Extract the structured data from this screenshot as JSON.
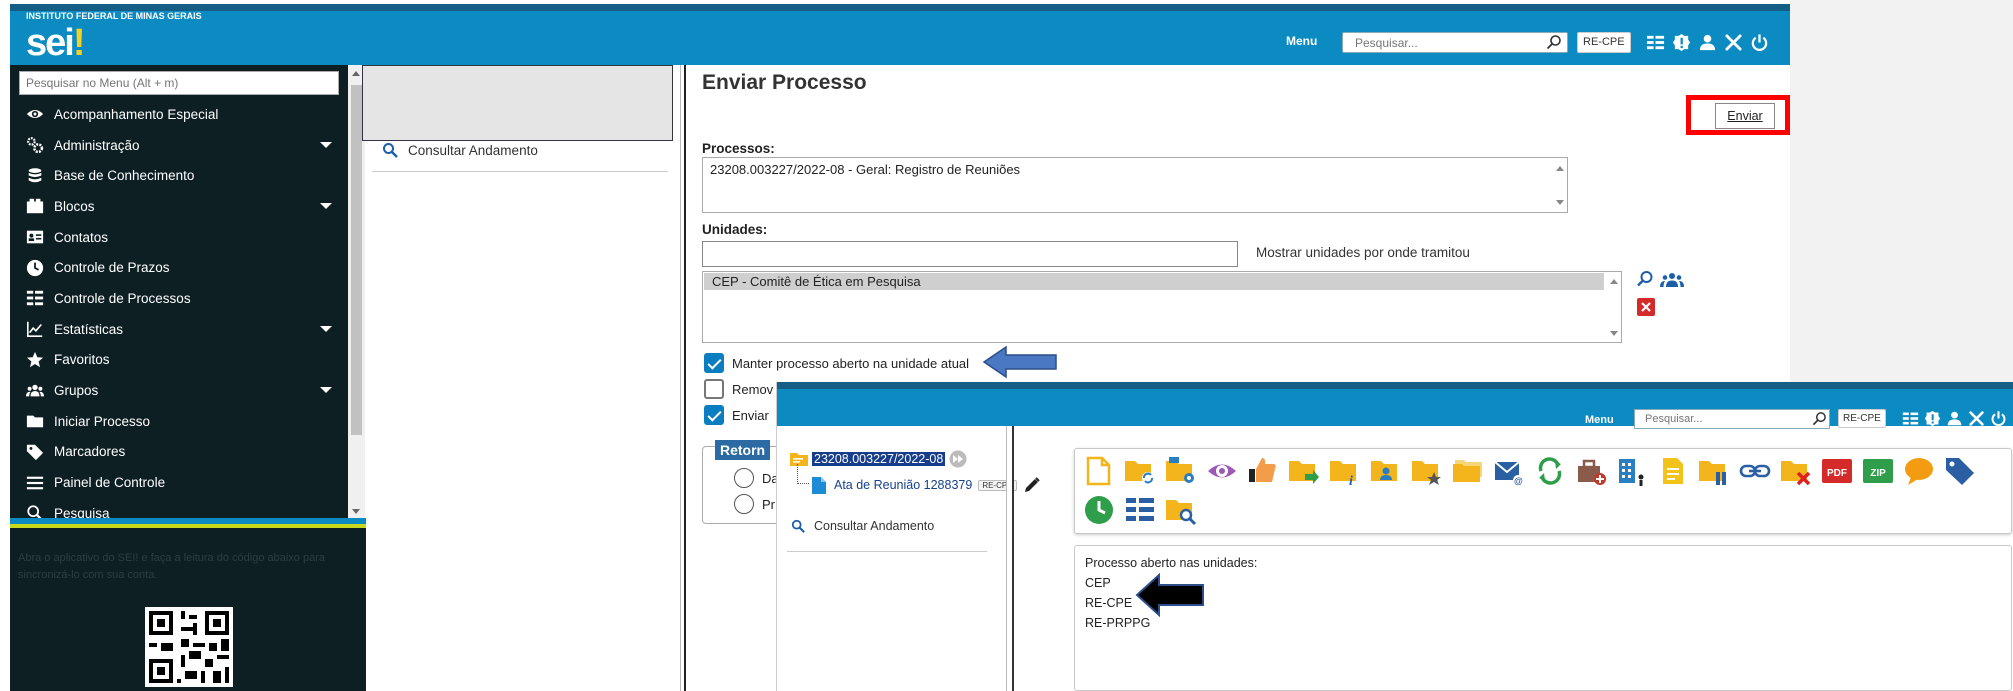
{
  "header": {
    "institution": "INSTITUTO FEDERAL DE MINAS GERAIS",
    "logo_main": "sei",
    "logo_mark": "!",
    "menu_label": "Menu",
    "search_placeholder": "Pesquisar...",
    "unit": "RE-CPE",
    "icons": [
      "grid-list-icon",
      "alert-icon",
      "user-icon",
      "tools-icon",
      "power-icon"
    ]
  },
  "sidebar": {
    "search_placeholder": "Pesquisar no Menu (Alt + m)",
    "items": [
      {
        "label": "Acompanhamento Especial",
        "icon": "eye-icon",
        "submenu": false
      },
      {
        "label": "Administração",
        "icon": "gears-icon",
        "submenu": true
      },
      {
        "label": "Base de Conhecimento",
        "icon": "database-icon",
        "submenu": false
      },
      {
        "label": "Blocos",
        "icon": "blocks-icon",
        "submenu": true
      },
      {
        "label": "Contatos",
        "icon": "contact-card-icon",
        "submenu": false
      },
      {
        "label": "Controle de Prazos",
        "icon": "clock-icon",
        "submenu": false
      },
      {
        "label": "Controle de Processos",
        "icon": "list-icon",
        "submenu": false
      },
      {
        "label": "Estatísticas",
        "icon": "chart-icon",
        "submenu": true
      },
      {
        "label": "Favoritos",
        "icon": "star-icon",
        "submenu": false
      },
      {
        "label": "Grupos",
        "icon": "group-icon",
        "submenu": true
      },
      {
        "label": "Iniciar Processo",
        "icon": "folder-icon",
        "submenu": false
      },
      {
        "label": "Marcadores",
        "icon": "tag-icon",
        "submenu": false
      },
      {
        "label": "Painel de Controle",
        "icon": "menu-lines-icon",
        "submenu": false
      },
      {
        "label": "Pesquisa",
        "icon": "search-icon",
        "submenu": false
      }
    ],
    "qr_text": "Abra o aplicativo do SEI! e faça a leitura do código abaixo para sincronizá-lo com sua conta."
  },
  "middle": {
    "consultar_label": "Consultar Andamento"
  },
  "main": {
    "title": "Enviar Processo",
    "enviar_button": "Enviar",
    "processos_label": "Processos:",
    "processo_item": "23208.003227/2022-08 - Geral: Registro de Reuniões",
    "unidades_label": "Unidades:",
    "mostrar_label": "Mostrar unidades por onde tramitou",
    "unidade_item": "CEP - Comitê de Ética em Pesquisa",
    "checkboxes": [
      {
        "label": "Manter processo aberto na unidade atual",
        "checked": true
      },
      {
        "label": "Remov",
        "checked": false
      },
      {
        "label": "Enviar",
        "checked": true
      }
    ],
    "retorno_label": "Retorn",
    "radio_labels": [
      "Da",
      "Pr"
    ]
  },
  "inset": {
    "menu_label": "Menu",
    "search_placeholder": "Pesquisar...",
    "unit": "RE-CPE",
    "process_number": "23208.003227/2022-08",
    "document_label": "Ata de Reunião 1288379",
    "document_badge": "RE-CPE",
    "consultar_label": "Consultar Andamento",
    "info_title": "Processo aberto nas unidades:",
    "open_units": [
      "CEP",
      "RE-CPE",
      "RE-PRPPG"
    ],
    "toolbar_text": {
      "pdf": "PDF",
      "zip": "ZIP"
    }
  },
  "colors": {
    "header_blue": "#0b8bc1",
    "header_dark": "#155f86",
    "sidebar_bg": "#0e1f24",
    "highlight_red": "#ff0000",
    "arrow_blue": "#4a78c2",
    "arrow_black": "#000000"
  }
}
